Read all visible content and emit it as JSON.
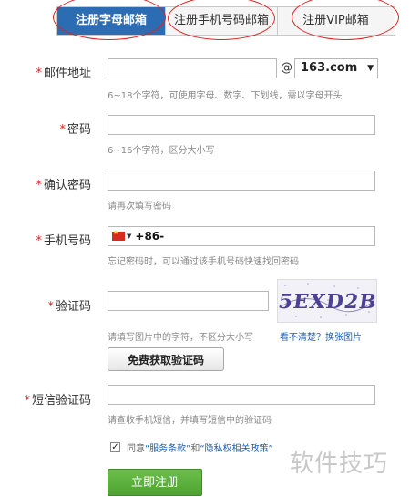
{
  "tabs": [
    {
      "label": "注册字母邮箱",
      "active": true
    },
    {
      "label": "注册手机号码邮箱",
      "active": false
    },
    {
      "label": "注册VIP邮箱",
      "active": false
    }
  ],
  "required_mark": "*",
  "email": {
    "label": "邮件地址",
    "value": "",
    "at": "@",
    "domain": "163.com",
    "hint": "6~18个字符，可使用字母、数字、下划线，需以字母开头"
  },
  "password": {
    "label": "密码",
    "value": "",
    "hint": "6~16个字符，区分大小写"
  },
  "confirm_password": {
    "label": "确认密码",
    "value": "",
    "hint": "请再次填写密码"
  },
  "phone": {
    "label": "手机号码",
    "country_code": "+86-",
    "hint": "忘记密码时，可以通过该手机号码快速找回密码"
  },
  "captcha": {
    "label": "验证码",
    "value": "",
    "hint": "请填写图片中的字符，不区分大小写",
    "refresh_link": "看不清楚？换张图片",
    "image_text": "5EXD2B"
  },
  "sms_button": "免费获取验证码",
  "sms_code": {
    "label": "短信验证码",
    "value": "",
    "hint": "请查收手机短信，并填写短信中的验证码"
  },
  "agreement": {
    "checked": true,
    "check_mark": "✓",
    "prefix": "同意",
    "terms": "“服务条款”",
    "and": "和",
    "privacy": "“隐私权相关政策”"
  },
  "submit_label": "立即注册",
  "watermark": "软件技巧",
  "colors": {
    "accent_blue": "#2b6cb3",
    "required_red": "#e02020",
    "link_blue": "#1a5fb4",
    "submit_green": "#5aae3c",
    "annotation_red": "#e02020"
  }
}
